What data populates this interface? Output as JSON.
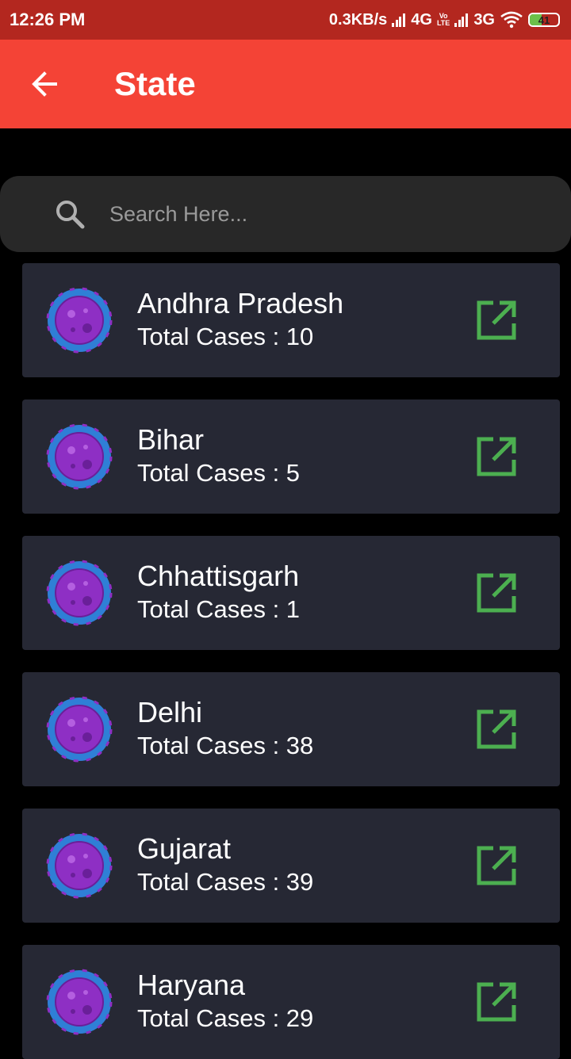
{
  "status_bar": {
    "time": "12:26 PM",
    "net_speed": "0.3KB/s",
    "network1": "4G",
    "volte_top": "Vo",
    "volte_bottom": "LTE",
    "network2": "3G",
    "battery": "41"
  },
  "app_bar": {
    "title": "State"
  },
  "search": {
    "placeholder": "Search Here..."
  },
  "colors": {
    "status_bar": "#B3271F",
    "app_bar": "#F44336",
    "card": "#262834",
    "open_icon": "#4CAF50",
    "virus_ring": "#2F7FD6",
    "virus_body": "#8E2FC4"
  },
  "states": [
    {
      "name": "Andhra Pradesh",
      "cases": "Total Cases : 10"
    },
    {
      "name": "Bihar",
      "cases": "Total Cases : 5"
    },
    {
      "name": "Chhattisgarh",
      "cases": "Total Cases : 1"
    },
    {
      "name": "Delhi",
      "cases": "Total Cases : 38"
    },
    {
      "name": "Gujarat",
      "cases": "Total Cases : 39"
    },
    {
      "name": "Haryana",
      "cases": "Total Cases : 29"
    }
  ]
}
